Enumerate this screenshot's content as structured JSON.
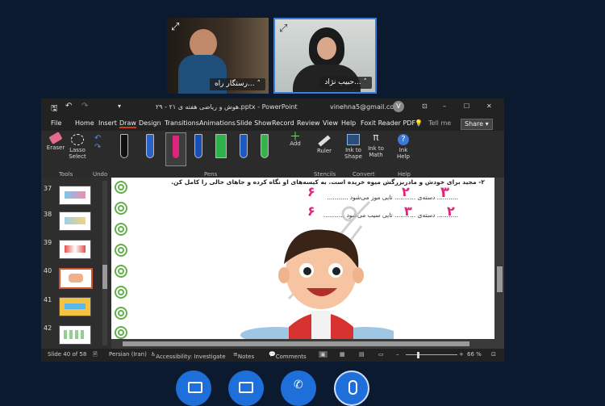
{
  "participants": [
    {
      "name": "رستگار راه..."
    },
    {
      "name": "حبیب نژاد..."
    }
  ],
  "window": {
    "title": "هوش و ریاضی هفته ی ۲۱ - ۲۹.pptx - PowerPoint",
    "account": "vinehna5@gmail.com",
    "avatar_letter": "V",
    "controls": [
      "⊡",
      "–",
      "☐",
      "✕"
    ]
  },
  "menu": [
    "File",
    "Home",
    "Insert",
    "Draw",
    "Design",
    "Transitions",
    "Animations",
    "Slide Show",
    "Record",
    "Review",
    "View",
    "Help",
    "Foxit Reader PDF"
  ],
  "menu_active": "Draw",
  "tell_me": "Tell me",
  "share": "Share",
  "ribbon": {
    "eraser": "Eraser",
    "lasso": "Lasso Select",
    "tools_group": "Tools",
    "undo_group": "Undo",
    "pens_group": "Pens",
    "add": "Add",
    "ruler": "Ruler",
    "stencils_group": "Stencils",
    "ink_to_shape": "Ink to Shape",
    "ink_to_math": "Ink to Math",
    "convert_group": "Convert",
    "ink_help": "Ink Help",
    "help_group": "Help"
  },
  "thumbnails": [
    {
      "num": "37"
    },
    {
      "num": "38"
    },
    {
      "num": "39"
    },
    {
      "num": "40"
    },
    {
      "num": "41"
    },
    {
      "num": "42"
    }
  ],
  "slide": {
    "line1": "۲- مجید برای خودش و مادربزرگش میوه خریده است. به کیسه‌های او نگاه کرده و جاهای خالی را کامل کن.",
    "line2": "........... دسته‌ی ........... تایی موز می‌شود ...........",
    "line3": "........... دسته‌ی ........... تایی سیب می‌شود ...........",
    "ink2a": "۳",
    "ink2b": "۲",
    "ink2c": "۶",
    "ink3a": "۲",
    "ink3b": "۳",
    "ink3c": "۶"
  },
  "status": {
    "slide": "Slide 40 of 58",
    "language": "Persian (Iran)",
    "accessibility": "Accessibility: Investigate",
    "notes": "Notes",
    "comments": "Comments",
    "zoom": "66 %"
  },
  "colors": {
    "ink": "#e0247a",
    "accent": "#1e6fd9"
  }
}
